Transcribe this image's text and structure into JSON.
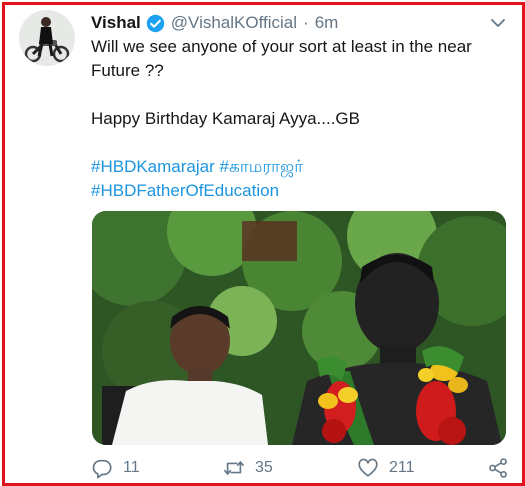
{
  "tweet": {
    "author_name": "Vishal",
    "handle": "@VishalKOfficial",
    "separator": "·",
    "time": "6m",
    "text_line_1": "Will we see anyone of your sort at least in the near",
    "text_line_2": "Future ??",
    "text_line_3": "Happy Birthday Kamaraj Ayya....GB",
    "hashtag_1": "#HBDKamarajar",
    "hashtag_2": "#காமராஜர்",
    "hashtag_3": "#HBDFatherOfEducation"
  },
  "actions": {
    "reply_count": "11",
    "retweet_count": "35",
    "like_count": "211"
  },
  "icons": {
    "verified": "verified-badge-icon",
    "menu": "chevron-down-icon",
    "reply": "reply-icon",
    "retweet": "retweet-icon",
    "like": "heart-icon",
    "share": "share-icon"
  },
  "colors": {
    "frame_border": "#e3121b",
    "link": "#1b95e0",
    "verified": "#1da1f2",
    "secondary_text": "#657786"
  }
}
